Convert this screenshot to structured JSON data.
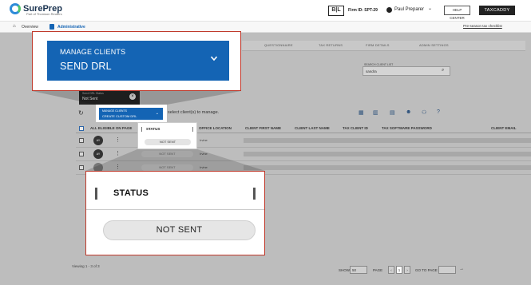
{
  "app": {
    "logo_text": "SurePrep",
    "logo_sub": "Part of Thomson Reuters",
    "bl_badge": "B|L",
    "firm_id": "Firm ID: SPT-29",
    "user_name": "Paul Preparer",
    "help_label": "HELP CENTER",
    "taxcaddy_label": "TAXCADDY"
  },
  "nav": {
    "overview": "Overview",
    "administrative": "Administrative",
    "checklist": "Pre-season tax checklist"
  },
  "tabs": [
    "QUESTIONNAIRE",
    "TAX RETURNS",
    "FIRM DETAILS",
    "ADMIN SETTINGS"
  ],
  "search": {
    "label": "SEARCH CLIENT LIST",
    "value": "sandra"
  },
  "toolbar": {
    "hint": "select client(s) to manage."
  },
  "table": {
    "headers": [
      "ALL ELIGIBLE ON PAGE",
      "STATUS",
      "OFFICE LOCATION",
      "CLIENT FIRST NAME",
      "CLIENT LAST NAME",
      "TAX CLIENT ID",
      "TAX SOFTWARE PASSWORD",
      "CLIENT EMAIL"
    ],
    "rows": [
      {
        "avatar": "AY",
        "status": "NOT SENT",
        "office": "Irvine"
      },
      {
        "avatar": "AY",
        "status": "NOT SENT",
        "office": "Irvine"
      },
      {
        "avatar": "",
        "status": "NOT SENT",
        "office": "Irvine"
      }
    ]
  },
  "footer": {
    "viewing": "Viewing 1 - 3 of 3",
    "show_label": "SHOW",
    "show_value": "50",
    "page_label": "PAGE",
    "page_current": "1",
    "goto_label": "GO TO PAGE"
  },
  "mini_dropdown": {
    "label": "Send DRL Status",
    "value": "Not Sent"
  },
  "mini_popup": {
    "line1": "MANAGE CLIENTS",
    "line2": "CREATE CUSTOM DRL"
  },
  "mini_status": {
    "title": "STATUS",
    "pill": "NOT SENT"
  },
  "zoom_manage": {
    "line1": "MANAGE CLIENTS",
    "line2": "SEND DRL"
  },
  "zoom_status": {
    "title": "STATUS",
    "pill": "NOT SENT"
  },
  "colors": {
    "brand_blue": "#1464b4",
    "callout_border": "#c0392b",
    "overlay": "#bdbdbd"
  }
}
